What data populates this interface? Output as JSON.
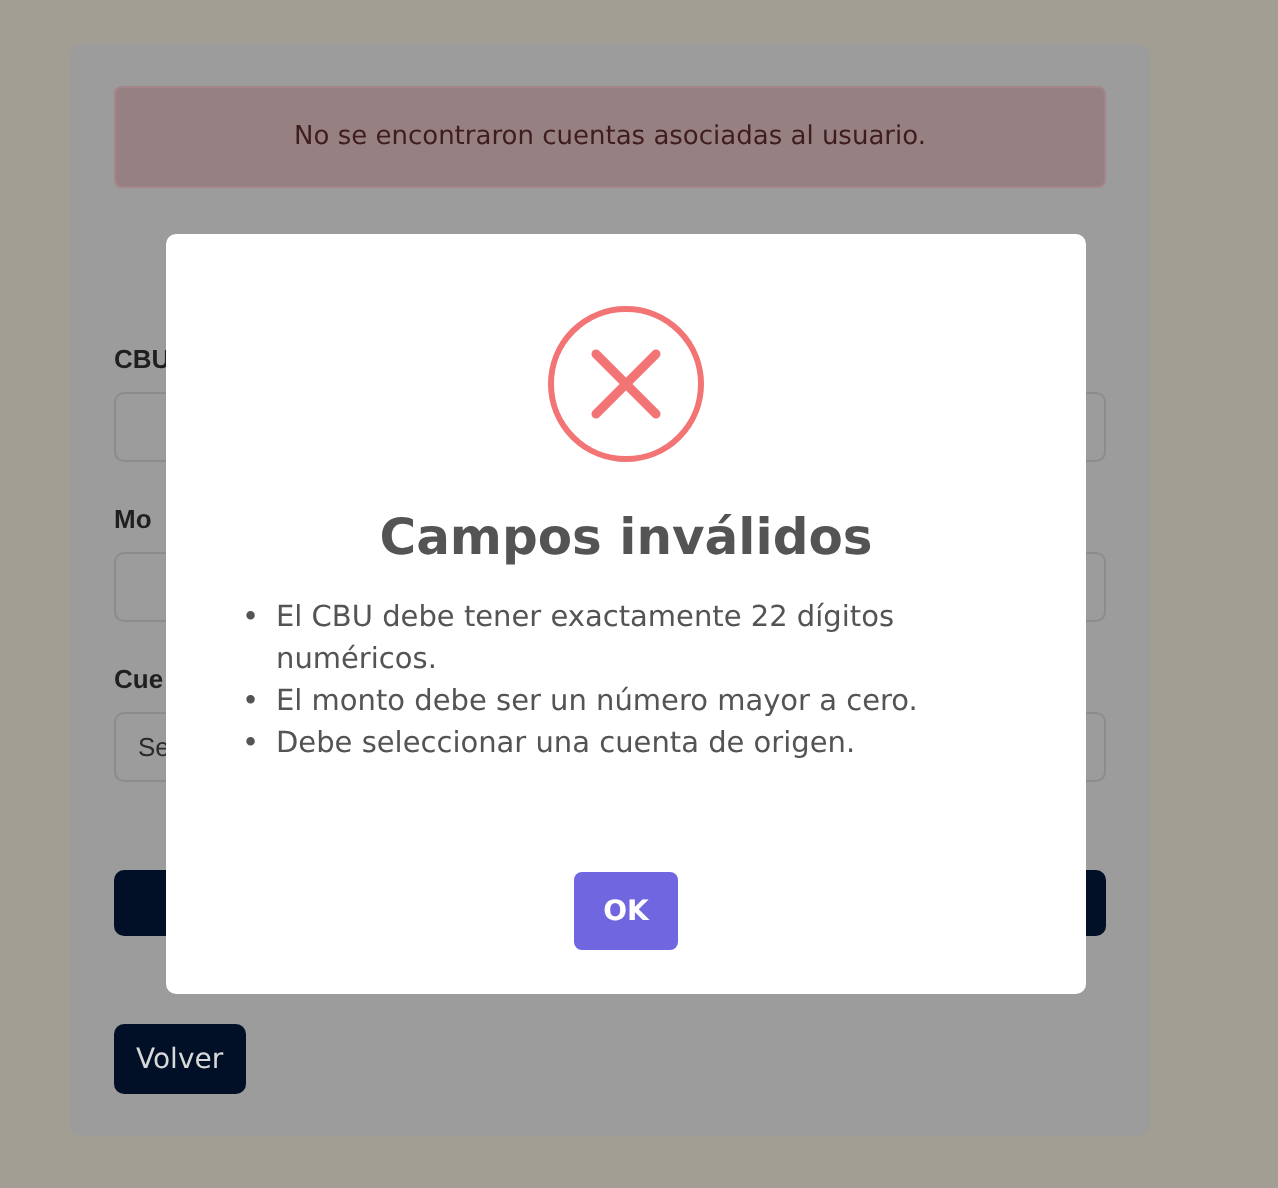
{
  "alert": {
    "message": "No se encontraron cuentas asociadas al usuario."
  },
  "form": {
    "fields": [
      {
        "label": "CBU"
      },
      {
        "label": "Mo"
      },
      {
        "label": "Cue",
        "value": "Se"
      }
    ]
  },
  "back_button": {
    "label": "Volver"
  },
  "modal": {
    "title": "Campos inválidos",
    "errors": [
      {
        "bullet": "•",
        "text": "El CBU debe tener exactamente 22 dígitos numéricos."
      },
      {
        "bullet": "•",
        "text": "El monto debe ser un número mayor a cero."
      },
      {
        "bullet": "•",
        "text": "Debe seleccionar una cuenta de origen."
      }
    ],
    "confirm_button": {
      "label": "OK"
    }
  }
}
